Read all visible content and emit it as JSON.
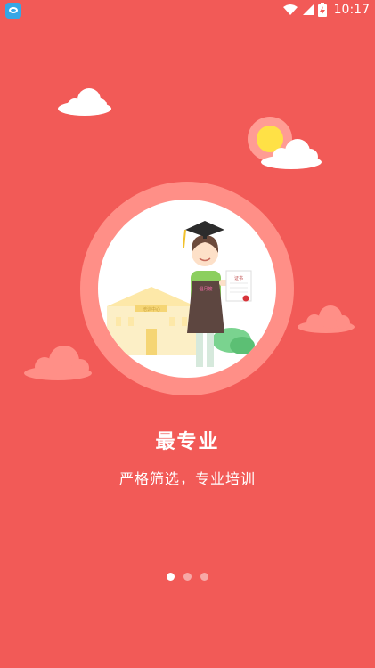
{
  "status_bar": {
    "time": "10:17",
    "icons": [
      "app-notification-icon",
      "wifi-icon",
      "signal-icon",
      "battery-charging-icon"
    ]
  },
  "illustration": {
    "apron_label": "倡月嫂",
    "certificate_label": "证书",
    "building_label": "培训中心"
  },
  "onboarding": {
    "title": "最专业",
    "subtitle": "严格筛选，专业培训"
  },
  "pager": {
    "count": 3,
    "active_index": 0
  },
  "colors": {
    "background": "#f25a57",
    "ring": "#ff8f87",
    "sun": "#ffe146",
    "dot_inactive": "#f7a8a6",
    "dot_active": "#ffffff"
  }
}
